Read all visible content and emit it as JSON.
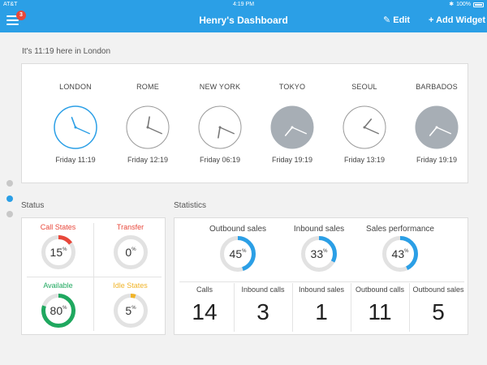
{
  "status_bar": {
    "carrier": "AT&T",
    "time": "4:19 PM",
    "battery": "100%"
  },
  "nav": {
    "title": "Henry's Dashboard",
    "menu_badge": "3",
    "edit_label": "Edit",
    "add_widget_label": "+ Add Widget",
    "edit_icon": "pencil-icon",
    "menu_icon": "hamburger-icon"
  },
  "local_time_text": "It's 11:19 here in London",
  "clocks": [
    {
      "city": "LONDON",
      "time": "Friday 11:19",
      "hour": 11,
      "minute": 19,
      "night": false,
      "highlight": true
    },
    {
      "city": "ROME",
      "time": "Friday 12:19",
      "hour": 12,
      "minute": 19,
      "night": false,
      "highlight": false
    },
    {
      "city": "NEW YORK",
      "time": "Friday 06:19",
      "hour": 6,
      "minute": 19,
      "night": false,
      "highlight": false
    },
    {
      "city": "TOKYO",
      "time": "Friday 19:19",
      "hour": 19,
      "minute": 19,
      "night": true,
      "highlight": false
    },
    {
      "city": "SEOUL",
      "time": "Friday 13:19",
      "hour": 13,
      "minute": 19,
      "night": false,
      "highlight": false
    },
    {
      "city": "BARBADOS",
      "time": "Friday 19:19",
      "hour": 19,
      "minute": 19,
      "night": true,
      "highlight": false
    }
  ],
  "page_dots": {
    "count": 3,
    "active": 1
  },
  "status_section": {
    "label": "Status",
    "items": [
      {
        "label": "Call States",
        "value": "15",
        "percent": 15,
        "color": "#e8473a"
      },
      {
        "label": "Transfer",
        "value": "0",
        "percent": 0,
        "color": "#e8473a"
      },
      {
        "label": "Available",
        "value": "80",
        "percent": 80,
        "color": "#1fa85f"
      },
      {
        "label": "Idle States",
        "value": "5",
        "percent": 5,
        "color": "#f0b429"
      }
    ],
    "percent_sign": "%"
  },
  "statistics_section": {
    "label": "Statistics",
    "gauges": [
      {
        "label": "Outbound sales",
        "value": "45",
        "percent": 45
      },
      {
        "label": "Inbound sales",
        "value": "33",
        "percent": 33
      },
      {
        "label": "Sales performance",
        "value": "43",
        "percent": 43
      }
    ],
    "metrics": [
      {
        "label": "Calls",
        "value": "14"
      },
      {
        "label": "Inbound calls",
        "value": "3"
      },
      {
        "label": "Inbound sales",
        "value": "1"
      },
      {
        "label": "Outbound calls",
        "value": "11"
      },
      {
        "label": "Outbound sales",
        "value": "5"
      }
    ],
    "accent": "#2b9fe6"
  }
}
